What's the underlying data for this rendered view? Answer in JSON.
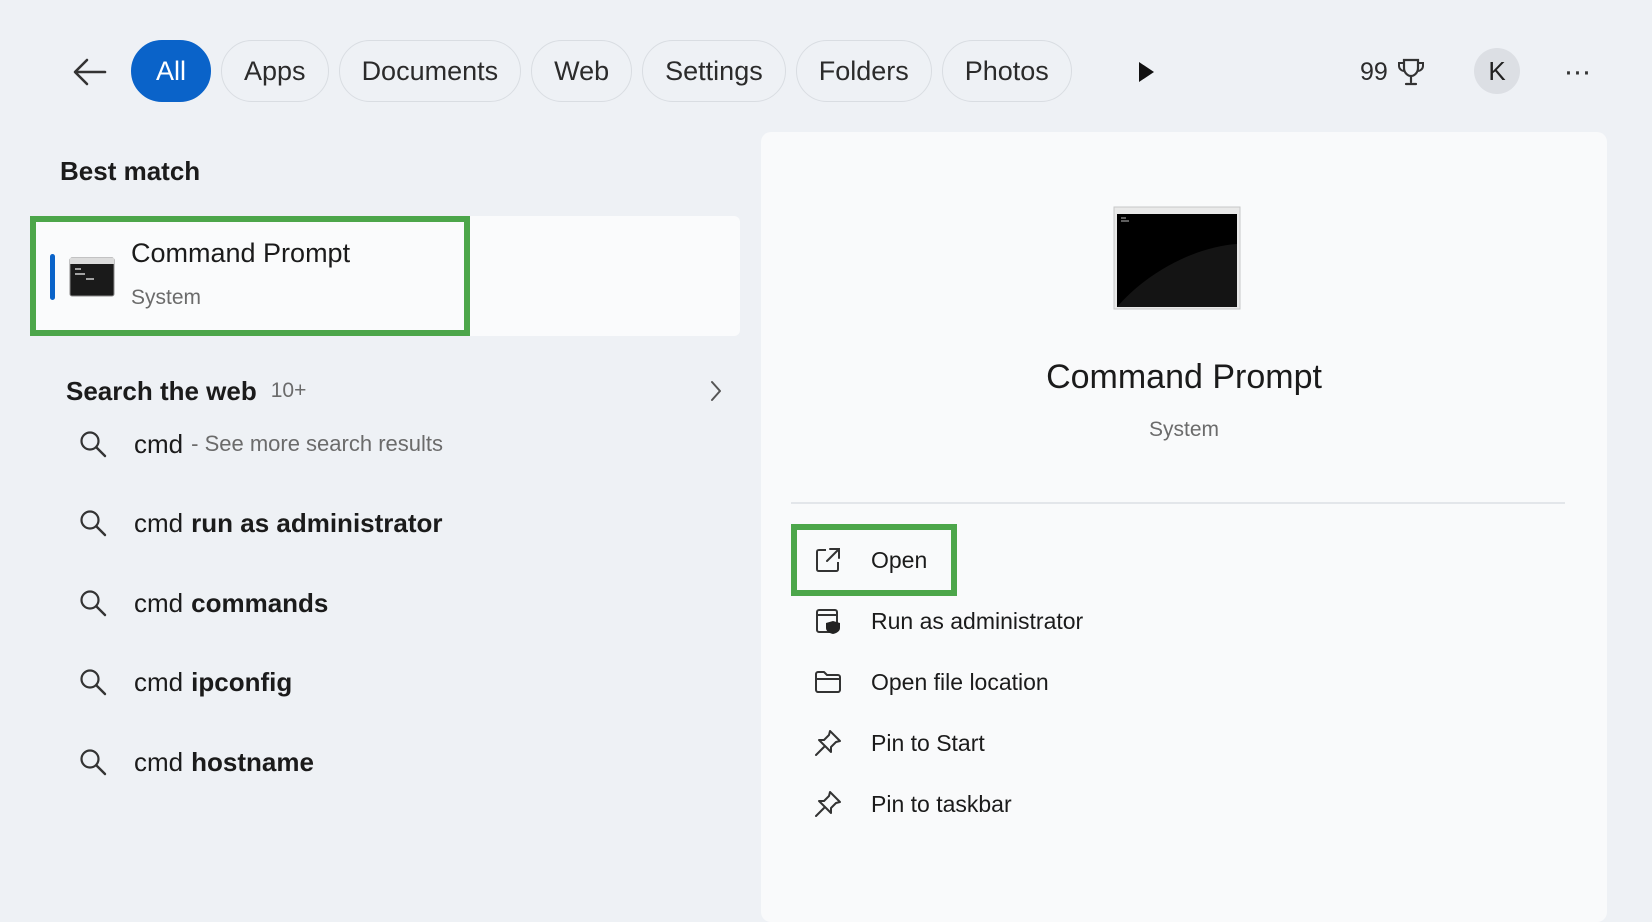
{
  "filters": {
    "back_label": "←",
    "chips": [
      "All",
      "Apps",
      "Documents",
      "Web",
      "Settings",
      "Folders",
      "Photos"
    ],
    "active": "All"
  },
  "header": {
    "points": "99",
    "avatar_initial": "K",
    "more_label": "···"
  },
  "best_match": {
    "section_title": "Best match",
    "title": "Command Prompt",
    "subtitle": "System",
    "icon": "cmd-icon"
  },
  "search_web": {
    "title": "Search the web",
    "count": "10+",
    "suggestions": [
      {
        "query": "cmd",
        "bold": "",
        "more": "- See more search results"
      },
      {
        "query": "cmd",
        "bold": "run as administrator",
        "more": ""
      },
      {
        "query": "cmd",
        "bold": "commands",
        "more": ""
      },
      {
        "query": "cmd",
        "bold": "ipconfig",
        "more": ""
      },
      {
        "query": "cmd",
        "bold": "hostname",
        "more": ""
      }
    ]
  },
  "detail": {
    "title": "Command Prompt",
    "subtitle": "System",
    "actions": [
      {
        "label": "Open",
        "icon": "open-external-icon"
      },
      {
        "label": "Run as administrator",
        "icon": "shield-window-icon"
      },
      {
        "label": "Open file location",
        "icon": "folder-icon"
      },
      {
        "label": "Pin to Start",
        "icon": "pin-icon"
      },
      {
        "label": "Pin to taskbar",
        "icon": "pin-icon"
      }
    ]
  },
  "colors": {
    "accent": "#0a63c9",
    "highlight": "#4ca64a",
    "background": "#eef1f5"
  }
}
